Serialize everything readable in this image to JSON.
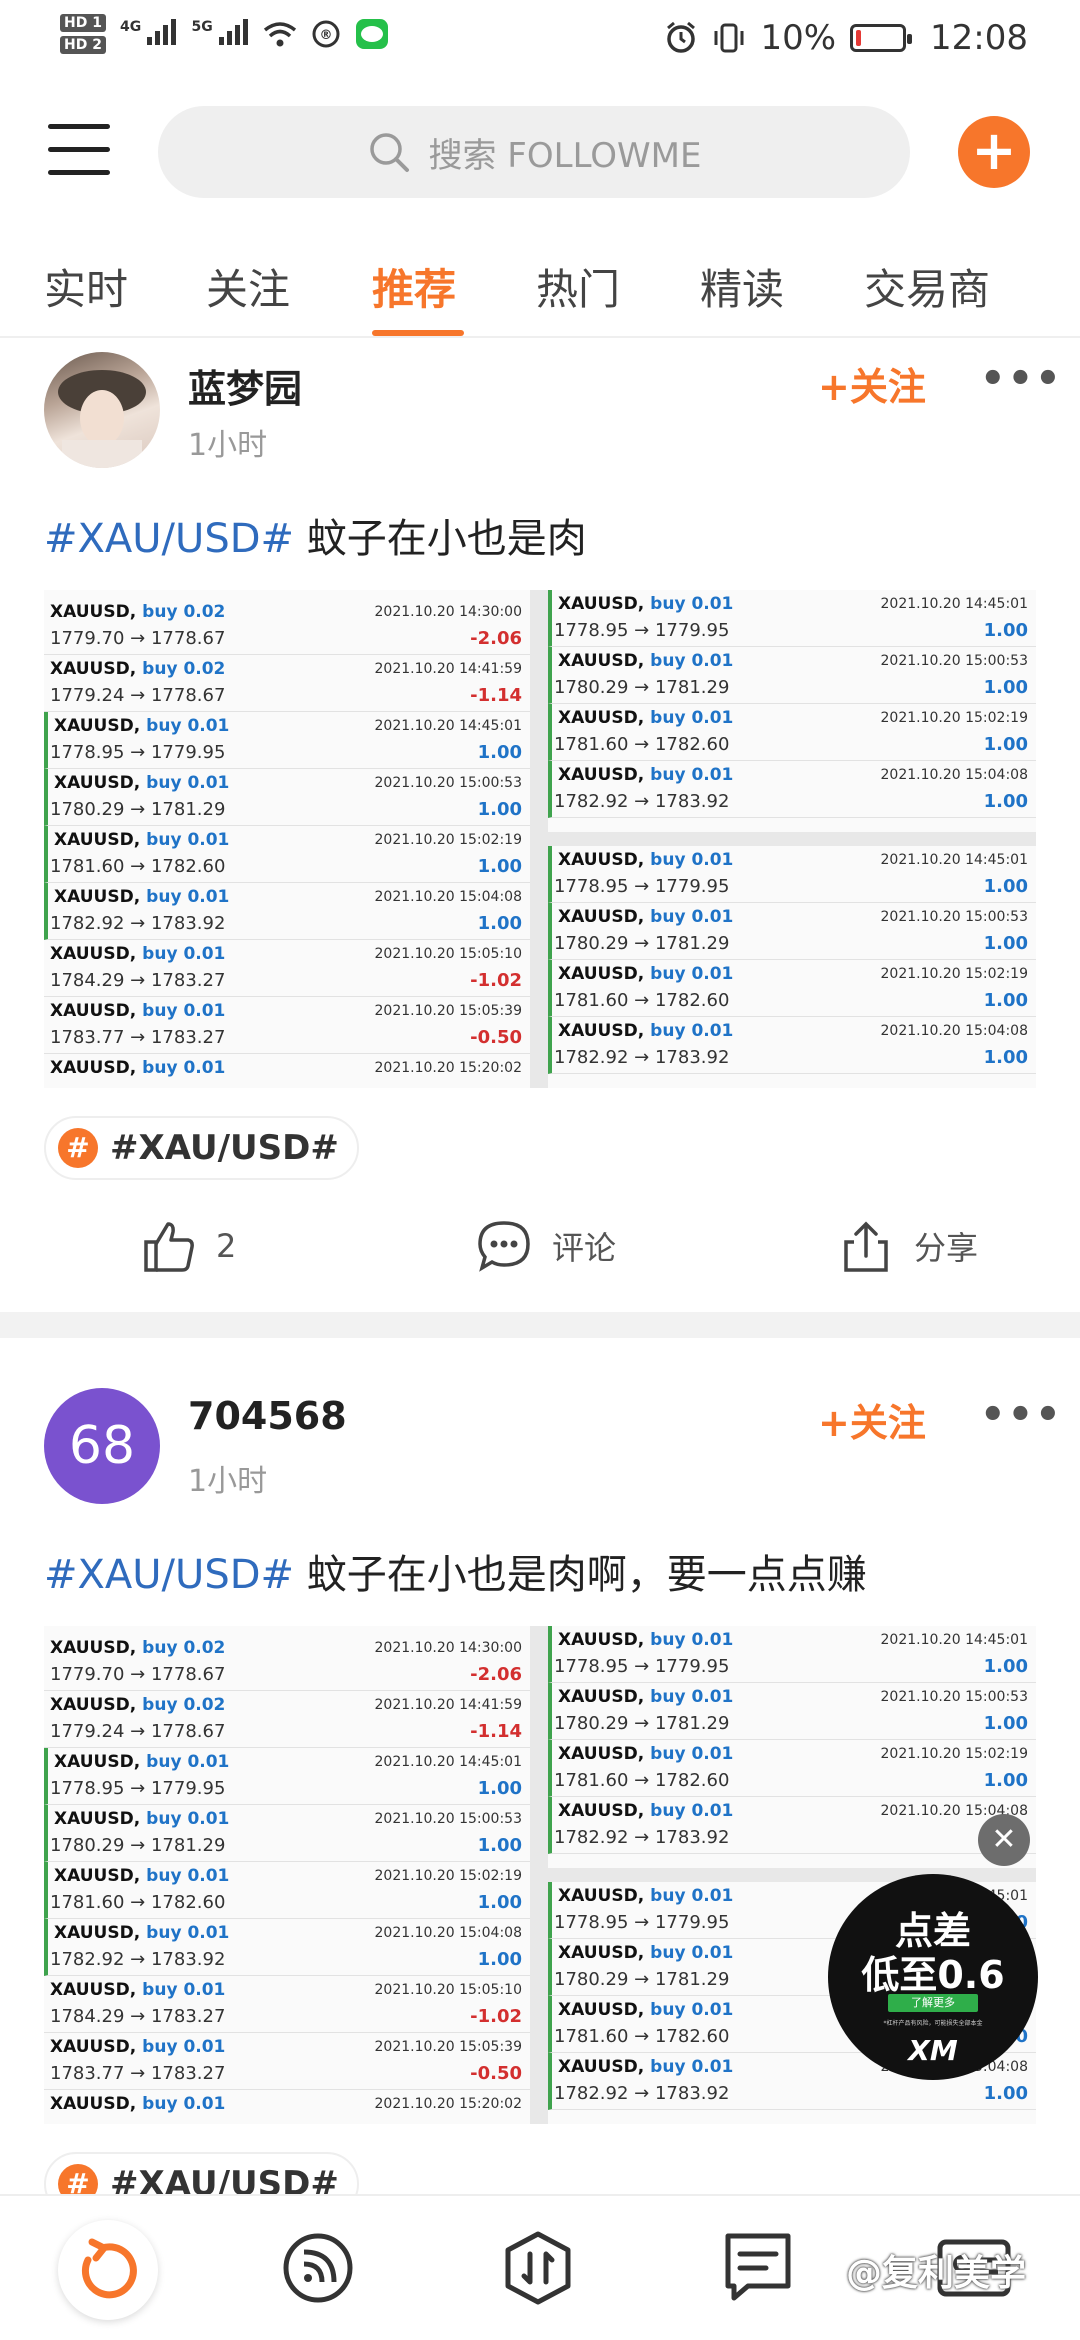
{
  "status_bar": {
    "hd1": "HD 1",
    "hd2": "HD 2",
    "net1": "4G",
    "net2": "5G",
    "battery_pct": "10%",
    "time": "12:08"
  },
  "header": {
    "search_placeholder": "搜索 FOLLOWME",
    "add_label": "+"
  },
  "tabs": [
    {
      "label": "实时"
    },
    {
      "label": "关注"
    },
    {
      "label": "推荐"
    },
    {
      "label": "热门"
    },
    {
      "label": "精读"
    },
    {
      "label": "交易商"
    }
  ],
  "active_tab": "推荐",
  "posts": [
    {
      "username": "蓝梦园",
      "time": "1小时",
      "follow": "+关注",
      "more": "•••",
      "tag": "#XAU/USD#",
      "text": " 蚊子在小也是肉",
      "topic": "#XAU/USD#",
      "likes": "2",
      "comment": "评论",
      "share": "分享"
    },
    {
      "username": "704568",
      "avatar_text": "68",
      "time": "1小时",
      "follow": "+关注",
      "more": "•••",
      "tag": "#XAU/USD#",
      "text": " 蚊子在小也是肉啊，要一点点赚",
      "topic": "#XAU/USD#"
    }
  ],
  "trades_left": [
    {
      "sym": "XAUUSD,",
      "act": "buy 0.02",
      "dt": "2021.10.20 14:30:00",
      "px": "1779.70 → 1778.67",
      "pl": "-2.06",
      "neg": true,
      "green": false
    },
    {
      "sym": "XAUUSD,",
      "act": "buy 0.02",
      "dt": "2021.10.20 14:41:59",
      "px": "1779.24 → 1778.67",
      "pl": "-1.14",
      "neg": true,
      "green": false
    },
    {
      "sym": "XAUUSD,",
      "act": "buy 0.01",
      "dt": "2021.10.20 14:45:01",
      "px": "1778.95 → 1779.95",
      "pl": "1.00",
      "neg": false,
      "green": true
    },
    {
      "sym": "XAUUSD,",
      "act": "buy 0.01",
      "dt": "2021.10.20 15:00:53",
      "px": "1780.29 → 1781.29",
      "pl": "1.00",
      "neg": false,
      "green": true
    },
    {
      "sym": "XAUUSD,",
      "act": "buy 0.01",
      "dt": "2021.10.20 15:02:19",
      "px": "1781.60 → 1782.60",
      "pl": "1.00",
      "neg": false,
      "green": true
    },
    {
      "sym": "XAUUSD,",
      "act": "buy 0.01",
      "dt": "2021.10.20 15:04:08",
      "px": "1782.92 → 1783.92",
      "pl": "1.00",
      "neg": false,
      "green": true
    },
    {
      "sym": "XAUUSD,",
      "act": "buy 0.01",
      "dt": "2021.10.20 15:05:10",
      "px": "1784.29 → 1783.27",
      "pl": "-1.02",
      "neg": true,
      "green": false
    },
    {
      "sym": "XAUUSD,",
      "act": "buy 0.01",
      "dt": "2021.10.20 15:05:39",
      "px": "1783.77 → 1783.27",
      "pl": "-0.50",
      "neg": true,
      "green": false
    },
    {
      "sym": "XAUUSD,",
      "act": "buy 0.01",
      "dt": "2021.10.20 15:20:02",
      "px": "",
      "pl": "",
      "neg": false,
      "green": false
    }
  ],
  "trades_right": [
    {
      "sym": "XAUUSD,",
      "act": "buy 0.01",
      "dt": "2021.10.20 14:45:01",
      "px": "1778.95 → 1779.95",
      "pl": "1.00",
      "neg": false,
      "green": true
    },
    {
      "sym": "XAUUSD,",
      "act": "buy 0.01",
      "dt": "2021.10.20 15:00:53",
      "px": "1780.29 → 1781.29",
      "pl": "1.00",
      "neg": false,
      "green": true
    },
    {
      "sym": "XAUUSD,",
      "act": "buy 0.01",
      "dt": "2021.10.20 15:02:19",
      "px": "1781.60 → 1782.60",
      "pl": "1.00",
      "neg": false,
      "green": true
    },
    {
      "sym": "XAUUSD,",
      "act": "buy 0.01",
      "dt": "2021.10.20 15:04:08",
      "px": "1782.92 → 1783.92",
      "pl": "1.00",
      "neg": false,
      "green": true
    }
  ],
  "ad": {
    "line1": "点差",
    "line2": "低至0.6",
    "cta": "了解更多",
    "fine": "*杠杆产品有风险，可能损失全部本金",
    "brand": "XM",
    "close": "✕"
  },
  "watermark": "@复利美学"
}
